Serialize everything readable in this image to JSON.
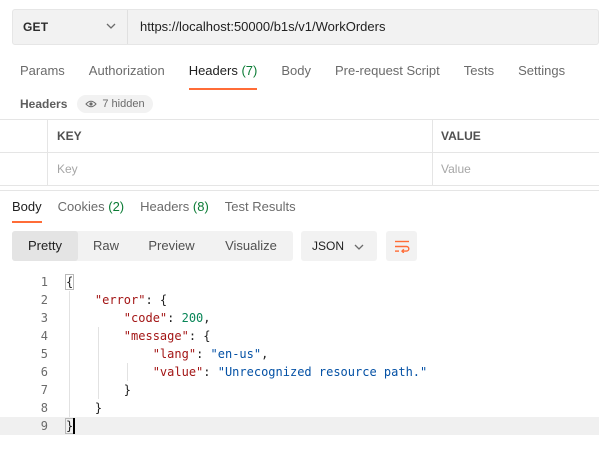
{
  "request": {
    "method": "GET",
    "url": "https://localhost:50000/b1s/v1/WorkOrders"
  },
  "request_tabs": [
    {
      "label": "Params",
      "count": ""
    },
    {
      "label": "Authorization",
      "count": ""
    },
    {
      "label": "Headers",
      "count": "(7)"
    },
    {
      "label": "Body",
      "count": ""
    },
    {
      "label": "Pre-request Script",
      "count": ""
    },
    {
      "label": "Tests",
      "count": ""
    },
    {
      "label": "Settings",
      "count": ""
    }
  ],
  "active_request_tab": "Headers",
  "headers_section": {
    "label": "Headers",
    "hidden_label": "7 hidden"
  },
  "headers_table": {
    "key_header": "KEY",
    "value_header": "VALUE",
    "key_placeholder": "Key",
    "value_placeholder": "Value"
  },
  "response_tabs": [
    {
      "label": "Body",
      "count": ""
    },
    {
      "label": "Cookies",
      "count": "(2)"
    },
    {
      "label": "Headers",
      "count": "(8)"
    },
    {
      "label": "Test Results",
      "count": ""
    }
  ],
  "active_response_tab": "Body",
  "view_modes": [
    "Pretty",
    "Raw",
    "Preview",
    "Visualize"
  ],
  "active_view_mode": "Pretty",
  "format": "JSON",
  "icons": {
    "method_dropdown": "chevron-down-icon",
    "hidden_toggle": "eye-icon",
    "format_dropdown": "chevron-down-icon",
    "wrap": "wrap-lines-icon"
  },
  "colors": {
    "accent": "#ff6c37",
    "count": "#0a7b34",
    "json_key": "#a31515",
    "json_string": "#0451a5",
    "json_number": "#098658"
  },
  "code_lines": [
    {
      "n": "1",
      "tokens": [
        {
          "t": "{",
          "c": "punc",
          "box": true
        }
      ]
    },
    {
      "n": "2",
      "tokens": [
        {
          "t": "    ",
          "c": "punc"
        },
        {
          "t": "\"error\"",
          "c": "key"
        },
        {
          "t": ": {",
          "c": "punc"
        }
      ]
    },
    {
      "n": "3",
      "tokens": [
        {
          "t": "        ",
          "c": "punc"
        },
        {
          "t": "\"code\"",
          "c": "key"
        },
        {
          "t": ": ",
          "c": "punc"
        },
        {
          "t": "200",
          "c": "num"
        },
        {
          "t": ",",
          "c": "punc"
        }
      ]
    },
    {
      "n": "4",
      "tokens": [
        {
          "t": "        ",
          "c": "punc"
        },
        {
          "t": "\"message\"",
          "c": "key"
        },
        {
          "t": ": {",
          "c": "punc"
        }
      ]
    },
    {
      "n": "5",
      "tokens": [
        {
          "t": "            ",
          "c": "punc"
        },
        {
          "t": "\"lang\"",
          "c": "key"
        },
        {
          "t": ": ",
          "c": "punc"
        },
        {
          "t": "\"en-us\"",
          "c": "str"
        },
        {
          "t": ",",
          "c": "punc"
        }
      ]
    },
    {
      "n": "6",
      "tokens": [
        {
          "t": "            ",
          "c": "punc"
        },
        {
          "t": "\"value\"",
          "c": "key"
        },
        {
          "t": ": ",
          "c": "punc"
        },
        {
          "t": "\"Unrecognized resource path.\"",
          "c": "str"
        }
      ]
    },
    {
      "n": "7",
      "tokens": [
        {
          "t": "        }",
          "c": "punc"
        }
      ]
    },
    {
      "n": "8",
      "tokens": [
        {
          "t": "    }",
          "c": "punc"
        }
      ]
    },
    {
      "n": "9",
      "tokens": [
        {
          "t": "}",
          "c": "punc",
          "box": true
        }
      ]
    }
  ]
}
